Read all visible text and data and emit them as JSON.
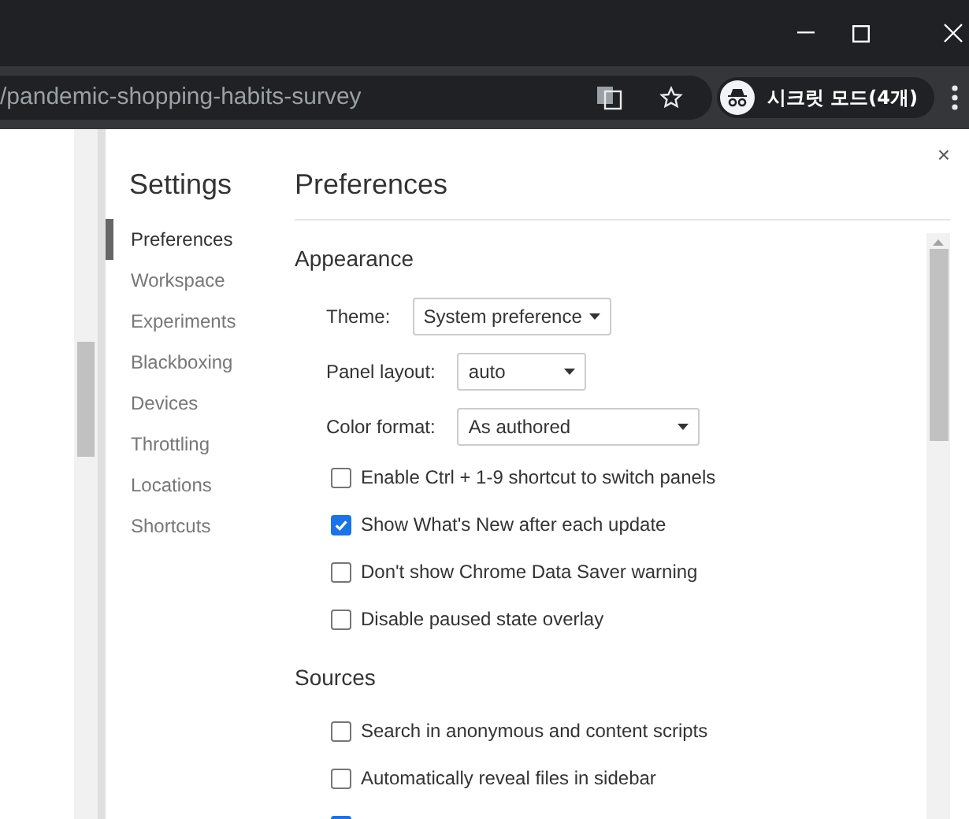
{
  "browser": {
    "address": "/pandemic-shopping-habits-survey",
    "profile": "시크릿 모드(4개)"
  },
  "settings": {
    "title": "Settings",
    "close": "×",
    "sidebar": [
      {
        "label": "Preferences",
        "selected": true
      },
      {
        "label": "Workspace",
        "selected": false
      },
      {
        "label": "Experiments",
        "selected": false
      },
      {
        "label": "Blackboxing",
        "selected": false
      },
      {
        "label": "Devices",
        "selected": false
      },
      {
        "label": "Throttling",
        "selected": false
      },
      {
        "label": "Locations",
        "selected": false
      },
      {
        "label": "Shortcuts",
        "selected": false
      }
    ],
    "heading": "Preferences",
    "sections": [
      {
        "title": "Appearance",
        "items": [
          {
            "kind": "select",
            "label": "Theme:",
            "value": "System preference"
          },
          {
            "kind": "select",
            "label": "Panel layout:",
            "value": "auto"
          },
          {
            "kind": "select",
            "label": "Color format:",
            "value": "As authored"
          },
          {
            "kind": "checkbox",
            "label": "Enable Ctrl + 1-9 shortcut to switch panels",
            "checked": false
          },
          {
            "kind": "checkbox",
            "label": "Show What's New after each update",
            "checked": true
          },
          {
            "kind": "checkbox",
            "label": "Don't show Chrome Data Saver warning",
            "checked": false
          },
          {
            "kind": "checkbox",
            "label": "Disable paused state overlay",
            "checked": false
          }
        ]
      },
      {
        "title": "Sources",
        "items": [
          {
            "kind": "checkbox",
            "label": "Search in anonymous and content scripts",
            "checked": false
          },
          {
            "kind": "checkbox",
            "label": "Automatically reveal files in sidebar",
            "checked": false
          },
          {
            "kind": "checkbox",
            "checked": true
          }
        ]
      }
    ]
  }
}
